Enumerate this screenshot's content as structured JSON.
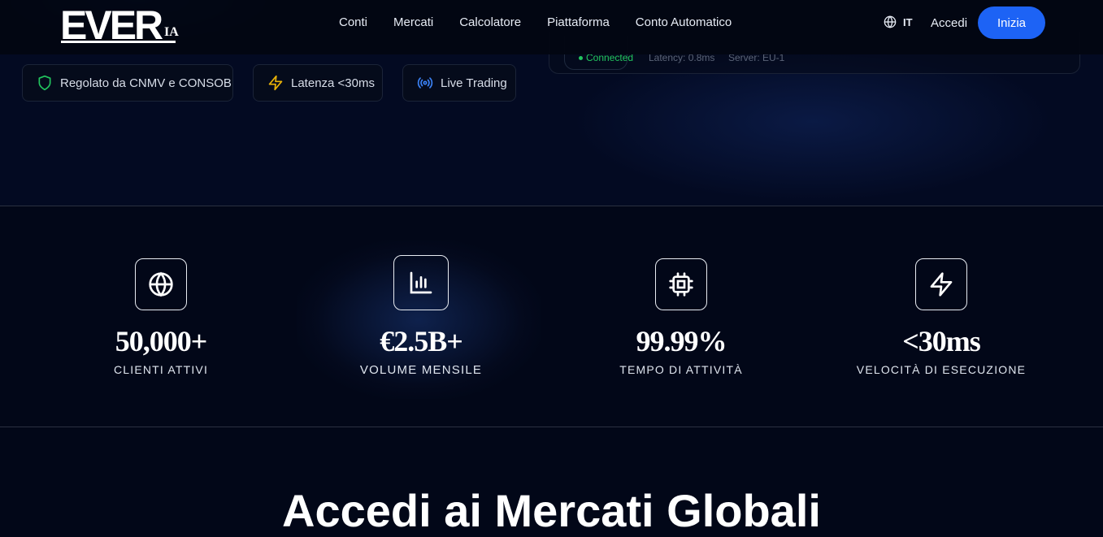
{
  "header": {
    "logo_text": "EVER",
    "logo_suffix": "IA",
    "nav": [
      {
        "label": "Conti"
      },
      {
        "label": "Mercati"
      },
      {
        "label": "Calcolatore"
      },
      {
        "label": "Piattaforma"
      },
      {
        "label": "Conto Automatico"
      }
    ],
    "language": "IT",
    "login_label": "Accedi",
    "cta_label": "Inizia"
  },
  "badges": [
    {
      "label": "Regolato da CNMV e CONSOB",
      "icon": "shield-icon",
      "color": "#22c55e"
    },
    {
      "label": "Latenza <30ms",
      "icon": "lightning-icon",
      "color": "#eab308"
    },
    {
      "label": "Live Trading",
      "icon": "broadcast-icon",
      "color": "#3b82f6"
    }
  ],
  "status": {
    "connected": "Connected",
    "latency": "Latency: 0.8ms",
    "server": "Server: EU-1"
  },
  "stats": [
    {
      "icon": "globe-icon",
      "value": "50,000+",
      "label": "CLIENTI ATTIVI"
    },
    {
      "icon": "bar-chart-icon",
      "value": "€2.5B+",
      "label": "VOLUME MENSILE"
    },
    {
      "icon": "cpu-icon",
      "value": "99.99%",
      "label": "TEMPO DI ATTIVITÀ"
    },
    {
      "icon": "lightning-icon",
      "value": "<30ms",
      "label": "VELOCITÀ DI ESECUZIONE"
    }
  ],
  "section": {
    "title": "Accedi ai Mercati Globali"
  }
}
